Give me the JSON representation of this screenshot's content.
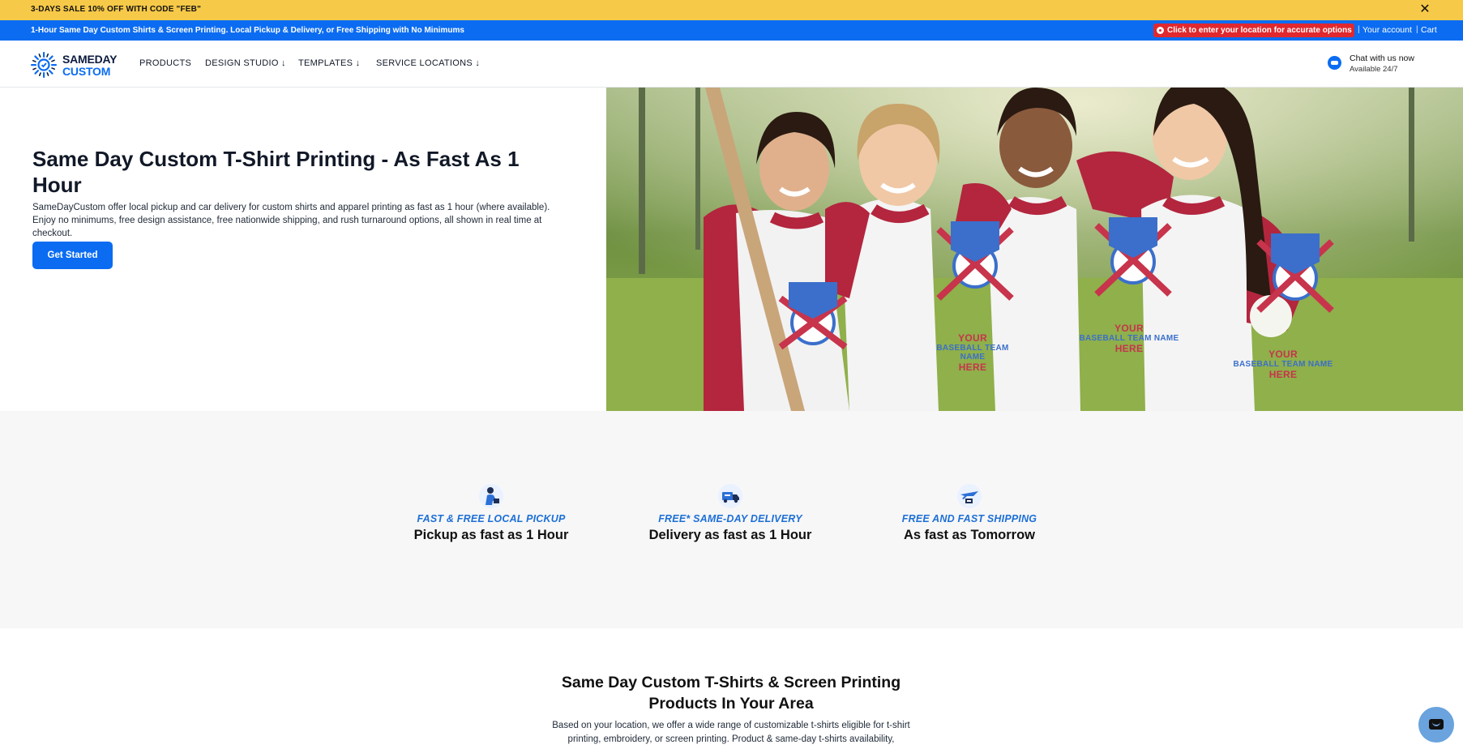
{
  "promo": {
    "text": "3-DAYS SALE 10% OFF WITH CODE \"FEB\"",
    "close_icon": "close-icon"
  },
  "infobar": {
    "text": "1-Hour Same Day Custom Shirts & Screen Printing. Local Pickup & Delivery, or Free Shipping with No Minimums",
    "location_cta": "Click to enter your location for accurate options",
    "account": "Your account",
    "cart": "Cart",
    "separator": "|"
  },
  "header": {
    "logo": {
      "line1": "SAMEDAY",
      "line2": "CUSTOM"
    },
    "nav": [
      {
        "label": "PRODUCTS"
      },
      {
        "label": "DESIGN STUDIO ↓"
      },
      {
        "label": "TEMPLATES ↓"
      },
      {
        "label": "SERVICE LOCATIONS ↓"
      }
    ],
    "chat": {
      "title": "Chat with us now",
      "subtitle": "Available 24/7"
    }
  },
  "hero": {
    "title": "Same Day Custom T-Shirt Printing - As Fast As 1 Hour",
    "description": "SameDayCustom offer local pickup and car delivery for custom shirts and apparel printing as fast as 1 hour (where available). Enjoy no minimums, free design assistance, free nationwide shipping, and rush turnaround options, all shown in real time at checkout.",
    "cta": "Get Started",
    "shirt_text": {
      "line1": "YOUR",
      "line2": "BASEBALL TEAM NAME",
      "line3": "HERE"
    }
  },
  "features": [
    {
      "icon": "pickup-person-icon",
      "kicker": "FAST & FREE LOCAL PICKUP",
      "title": "Pickup as fast as 1 Hour"
    },
    {
      "icon": "delivery-truck-icon",
      "kicker": "FREE* SAME-DAY DELIVERY",
      "title": "Delivery as fast as 1 Hour"
    },
    {
      "icon": "shipping-plane-icon",
      "kicker": "FREE AND FAST SHIPPING",
      "title": "As fast as Tomorrow"
    }
  ],
  "products": {
    "title": "Same Day Custom T-Shirts & Screen Printing Products In Your Area",
    "description": "Based on your location, we offer a wide range of customizable t-shirts eligible for t-shirt printing, embroidery, or screen printing. Product & same-day t-shirts availability,"
  },
  "colors": {
    "promo_bg": "#f7c948",
    "brand_blue": "#0b6cf2",
    "location_red": "#e0282e",
    "kicker_blue": "#1d6fd6",
    "shirt_red": "#b3263e"
  },
  "launcher": {
    "icon": "chat-bubble-icon"
  }
}
